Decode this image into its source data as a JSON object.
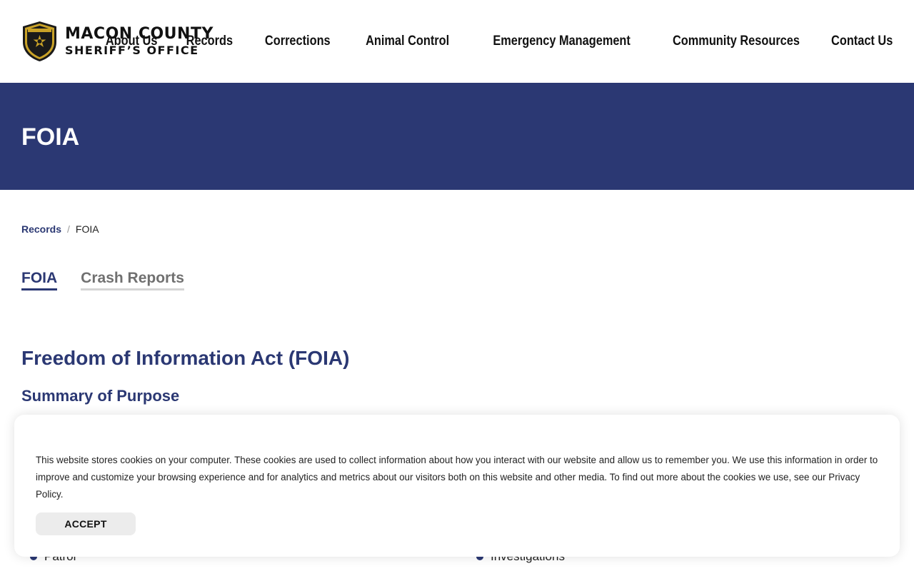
{
  "header": {
    "logo": {
      "line1": "MACON COUNTY",
      "line2": "SHERIFF’S OFFICE",
      "badge_icon": "sheriff-badge-icon"
    },
    "nav": [
      {
        "label": "About Us"
      },
      {
        "label": "Records"
      },
      {
        "label": "Corrections"
      },
      {
        "label": "Animal Control"
      },
      {
        "label": "Emergency Management"
      },
      {
        "label": "Community Resources"
      },
      {
        "label": "Contact Us"
      }
    ]
  },
  "hero": {
    "title": "FOIA"
  },
  "breadcrumb": {
    "parent": "Records",
    "separator": "/",
    "current": "FOIA"
  },
  "tabs": [
    {
      "label": "FOIA",
      "active": true
    },
    {
      "label": "Crash Reports",
      "active": false
    }
  ],
  "content": {
    "title": "Freedom of Information Act (FOIA)",
    "subtitle": "Summary of Purpose",
    "list_left": "Patrol",
    "list_right": "Investigations"
  },
  "cookie_banner": {
    "text": "This website stores cookies on your computer. These cookies are used to collect information about how you interact with our website and allow us to remember you. We use this information in order to improve and customize your browsing experience and for analytics and metrics about our visitors both on this website and other media. To find out more about the cookies we use, see our Privacy Policy.",
    "accept_label": "ACCEPT"
  },
  "colors": {
    "brand_navy": "#2b3873",
    "badge_gold": "#c9a227",
    "text_dark": "#111111"
  }
}
